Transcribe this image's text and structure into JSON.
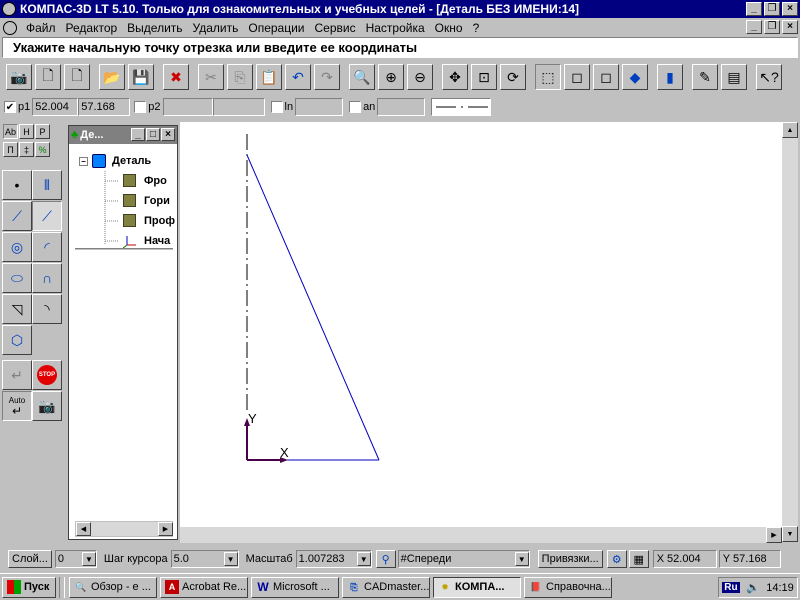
{
  "window": {
    "title": "КОМПАС-3D LT 5.10. Только для ознакомительных и учебных целей - [Деталь БЕЗ ИМЕНИ:14]"
  },
  "menu": [
    "Файл",
    "Редактор",
    "Выделить",
    "Удалить",
    "Операции",
    "Сервис",
    "Настройка",
    "Окно",
    "?"
  ],
  "prompt": "Укажите начальную точку отрезка или введите ее координаты",
  "params": {
    "p1_label": "p1",
    "p1_x": "52.004",
    "p1_y": "57.168",
    "p2_label": "p2",
    "ln_label": "ln",
    "an_label": "an"
  },
  "tree": {
    "caption": "Де...",
    "root": "Деталь",
    "items": [
      "Фро",
      "Гори",
      "Проф",
      "Нача"
    ]
  },
  "leftpanel": {
    "tabs": [
      "Ab",
      "H",
      "P",
      "П",
      "‡",
      "%"
    ],
    "auto_label": "Auto",
    "stop_label": "STOP"
  },
  "drawing": {
    "x_axis_label": "X",
    "y_axis_label": "Y",
    "colors": {
      "line": "#0000c0",
      "axis": "#4a004a"
    }
  },
  "statusbar": {
    "layer_label": "Слой...",
    "layer_value": "0",
    "step_label": "Шаг курсора",
    "step_value": "5.0",
    "scale_label": "Масштаб",
    "scale_value": "1.007283",
    "view_value": "#Спереди",
    "snap_label": "Привязки...",
    "x_label": "X",
    "x_value": "52.004",
    "y_label": "Y",
    "y_value": "57.168"
  },
  "taskbar": {
    "start": "Пуск",
    "tasks": [
      "Обзор - е ...",
      "Acrobat Re...",
      "Microsoft ...",
      "CADmaster...",
      "КОМПА...",
      "Справочна..."
    ],
    "lang": "Ru",
    "clock": "14:19"
  }
}
